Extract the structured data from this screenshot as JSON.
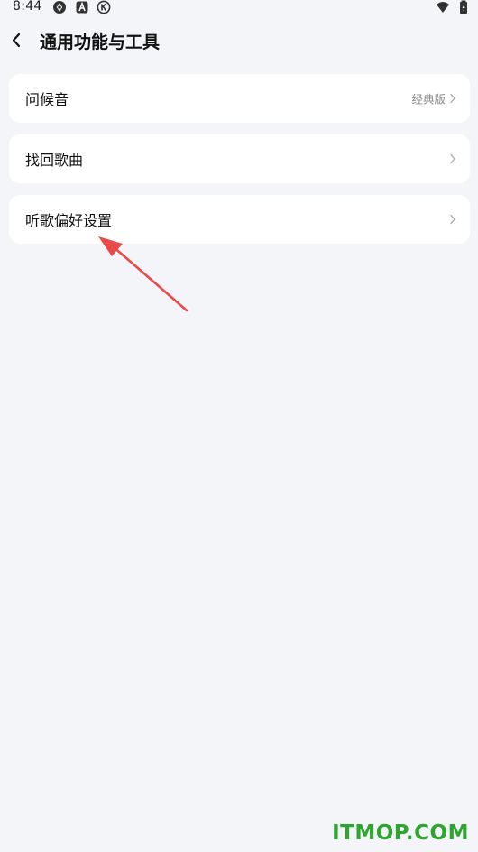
{
  "status_bar": {
    "time": "8:44",
    "icons": [
      "sync-icon",
      "a-badge-icon",
      "k-circle-icon",
      "wifi-icon",
      "battery-icon"
    ]
  },
  "header": {
    "back_icon": "chevron-left-icon",
    "title": "通用功能与工具"
  },
  "settings": {
    "items": [
      {
        "label": "问候音",
        "value": "经典版",
        "icon": "chevron-right-icon"
      },
      {
        "label": "找回歌曲",
        "value": "",
        "icon": "chevron-right-icon"
      },
      {
        "label": "听歌偏好设置",
        "value": "",
        "icon": "chevron-right-icon"
      }
    ]
  },
  "annotation": {
    "icon": "red-arrow-icon",
    "color": "#ea4a4a"
  },
  "watermark": {
    "text": "ITMOP.COM",
    "color": "#2fa52f"
  },
  "colors": {
    "background": "#f4f5f9",
    "card": "#ffffff",
    "text": "#111111",
    "secondary_text": "#8a8a8f"
  }
}
